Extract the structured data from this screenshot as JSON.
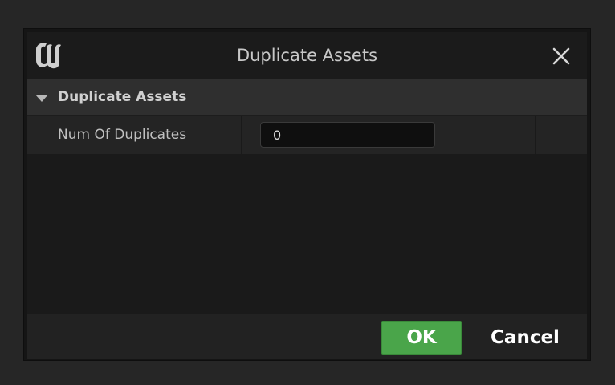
{
  "dialog": {
    "title": "Duplicate Assets",
    "logo_icon": "unreal-engine-logo",
    "close_icon": "close-icon"
  },
  "details": {
    "category_label": "Duplicate Assets",
    "properties": [
      {
        "name": "Num Of Duplicates",
        "value": "0"
      }
    ]
  },
  "footer": {
    "ok_label": "OK",
    "cancel_label": "Cancel"
  },
  "colors": {
    "ok_button": "#4aa54a",
    "background": "#262626",
    "panel": "#1a1a1a"
  }
}
